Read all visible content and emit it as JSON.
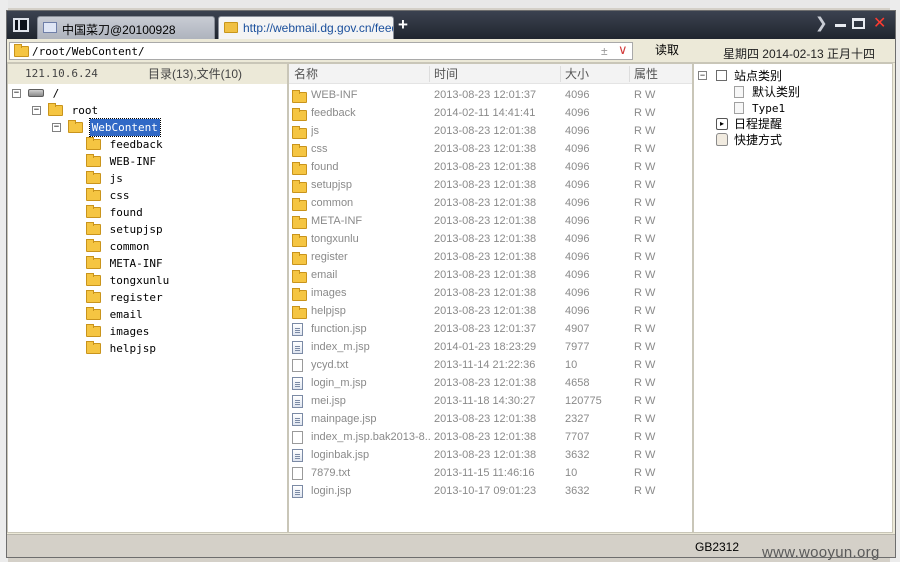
{
  "tabs": [
    {
      "label": "中国菜刀@20100928",
      "active": false
    },
    {
      "label": "http://webmail.dg.gov.cn/feedback/",
      "active": true
    }
  ],
  "address": {
    "path": "/root/WebContent/",
    "read_button": "读取",
    "date": "星期四 2014-02-13 正月十四"
  },
  "left_header": {
    "ip": "121.10.6.24",
    "counts": "目录(13),文件(10)"
  },
  "tree": [
    {
      "label": "/",
      "level": 0,
      "type": "drive"
    },
    {
      "label": "root",
      "level": 1,
      "type": "folder"
    },
    {
      "label": "WebContent",
      "level": 2,
      "type": "folder",
      "selected": true
    },
    {
      "label": "feedback",
      "level": 3,
      "type": "folder"
    },
    {
      "label": "WEB-INF",
      "level": 3,
      "type": "folder"
    },
    {
      "label": "js",
      "level": 3,
      "type": "folder"
    },
    {
      "label": "css",
      "level": 3,
      "type": "folder"
    },
    {
      "label": "found",
      "level": 3,
      "type": "folder"
    },
    {
      "label": "setupjsp",
      "level": 3,
      "type": "folder"
    },
    {
      "label": "common",
      "level": 3,
      "type": "folder"
    },
    {
      "label": "META-INF",
      "level": 3,
      "type": "folder"
    },
    {
      "label": "tongxunlu",
      "level": 3,
      "type": "folder"
    },
    {
      "label": "register",
      "level": 3,
      "type": "folder"
    },
    {
      "label": "email",
      "level": 3,
      "type": "folder"
    },
    {
      "label": "images",
      "level": 3,
      "type": "folder"
    },
    {
      "label": "helpjsp",
      "level": 3,
      "type": "folder"
    }
  ],
  "file_columns": {
    "name": "名称",
    "time": "时间",
    "size": "大小",
    "attr": "属性"
  },
  "files": [
    {
      "name": "WEB-INF",
      "time": "2013-08-23 12:01:37",
      "size": "4096",
      "attr": "R W",
      "type": "folder"
    },
    {
      "name": "feedback",
      "time": "2014-02-11 14:41:41",
      "size": "4096",
      "attr": "R W",
      "type": "folder"
    },
    {
      "name": "js",
      "time": "2013-08-23 12:01:38",
      "size": "4096",
      "attr": "R W",
      "type": "folder"
    },
    {
      "name": "css",
      "time": "2013-08-23 12:01:38",
      "size": "4096",
      "attr": "R W",
      "type": "folder"
    },
    {
      "name": "found",
      "time": "2013-08-23 12:01:38",
      "size": "4096",
      "attr": "R W",
      "type": "folder"
    },
    {
      "name": "setupjsp",
      "time": "2013-08-23 12:01:38",
      "size": "4096",
      "attr": "R W",
      "type": "folder"
    },
    {
      "name": "common",
      "time": "2013-08-23 12:01:38",
      "size": "4096",
      "attr": "R W",
      "type": "folder"
    },
    {
      "name": "META-INF",
      "time": "2013-08-23 12:01:38",
      "size": "4096",
      "attr": "R W",
      "type": "folder"
    },
    {
      "name": "tongxunlu",
      "time": "2013-08-23 12:01:38",
      "size": "4096",
      "attr": "R W",
      "type": "folder"
    },
    {
      "name": "register",
      "time": "2013-08-23 12:01:38",
      "size": "4096",
      "attr": "R W",
      "type": "folder"
    },
    {
      "name": "email",
      "time": "2013-08-23 12:01:38",
      "size": "4096",
      "attr": "R W",
      "type": "folder"
    },
    {
      "name": "images",
      "time": "2013-08-23 12:01:38",
      "size": "4096",
      "attr": "R W",
      "type": "folder"
    },
    {
      "name": "helpjsp",
      "time": "2013-08-23 12:01:38",
      "size": "4096",
      "attr": "R W",
      "type": "folder"
    },
    {
      "name": "function.jsp",
      "time": "2013-08-23 12:01:37",
      "size": "4907",
      "attr": "R W",
      "type": "file"
    },
    {
      "name": "index_m.jsp",
      "time": "2014-01-23 18:23:29",
      "size": "7977",
      "attr": "R W",
      "type": "file"
    },
    {
      "name": "ycyd.txt",
      "time": "2013-11-14 21:22:36",
      "size": "10",
      "attr": "R W",
      "type": "txt"
    },
    {
      "name": "login_m.jsp",
      "time": "2013-08-23 12:01:38",
      "size": "4658",
      "attr": "R W",
      "type": "file"
    },
    {
      "name": "mei.jsp",
      "time": "2013-11-18 14:30:27",
      "size": "120775",
      "attr": "R W",
      "type": "file"
    },
    {
      "name": "mainpage.jsp",
      "time": "2013-08-23 12:01:38",
      "size": "2327",
      "attr": "R W",
      "type": "file"
    },
    {
      "name": "index_m.jsp.bak2013-8...",
      "time": "2013-08-23 12:01:38",
      "size": "7707",
      "attr": "R W",
      "type": "txt"
    },
    {
      "name": "loginbak.jsp",
      "time": "2013-08-23 12:01:38",
      "size": "3632",
      "attr": "R W",
      "type": "file"
    },
    {
      "name": "7879.txt",
      "time": "2013-11-15 11:46:16",
      "size": "10",
      "attr": "R W",
      "type": "txt"
    },
    {
      "name": "login.jsp",
      "time": "2013-10-17 09:01:23",
      "size": "3632",
      "attr": "R W",
      "type": "file"
    }
  ],
  "right_panel": {
    "sites": "站点类别",
    "site_children": [
      "默认类别",
      "Type1"
    ],
    "schedule": "日程提醒",
    "shortcuts": "快捷方式"
  },
  "status": {
    "encoding": "GB2312"
  },
  "watermark": "www.wooyun.org"
}
